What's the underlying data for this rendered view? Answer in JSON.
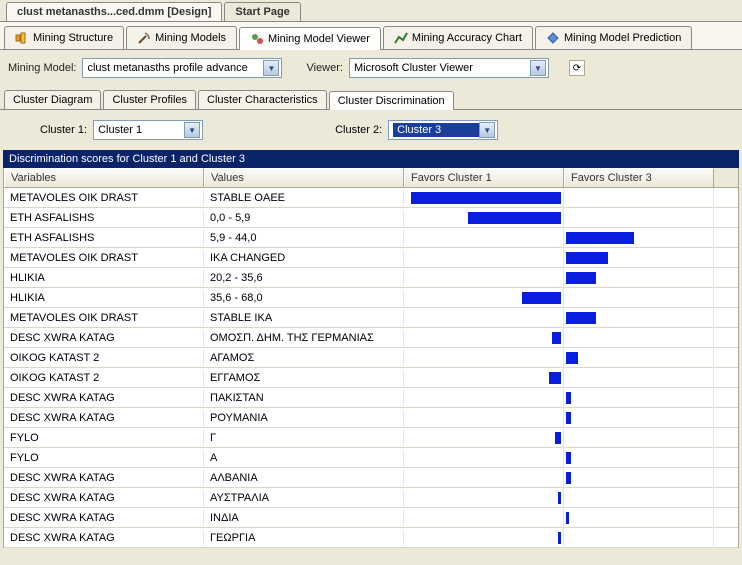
{
  "topTabs": {
    "design": "clust metanasths...ced.dmm [Design]",
    "startPage": "Start Page"
  },
  "toolTabs": {
    "miningStructure": "Mining Structure",
    "miningModels": "Mining Models",
    "miningModelViewer": "Mining Model Viewer",
    "miningAccuracyChart": "Mining Accuracy Chart",
    "miningModelPrediction": "Mining Model Prediction"
  },
  "labels": {
    "miningModel": "Mining Model:",
    "viewer": "Viewer:",
    "cluster1": "Cluster 1:",
    "cluster2": "Cluster 2:"
  },
  "dropdowns": {
    "miningModel": "clust metanasths profile advance",
    "viewer": "Microsoft Cluster Viewer",
    "cluster1": "Cluster 1",
    "cluster2": "Cluster 3"
  },
  "subTabs": {
    "clusterDiagram": "Cluster Diagram",
    "clusterProfiles": "Cluster Profiles",
    "clusterCharacteristics": "Cluster Characteristics",
    "clusterDiscrimination": "Cluster Discrimination"
  },
  "titleBar": "Discrimination scores for Cluster 1 and Cluster 3",
  "columns": {
    "variables": "Variables",
    "values": "Values",
    "favors1": "Favors Cluster 1",
    "favors2": "Favors Cluster 3"
  },
  "rows": [
    {
      "var": "METAVOLES OIK DRAST",
      "val": "STABLE OAEE",
      "f1": 100,
      "f2": 0
    },
    {
      "var": "ETH ASFALISHS",
      "val": "0,0 - 5,9",
      "f1": 62,
      "f2": 0
    },
    {
      "var": "ETH ASFALISHS",
      "val": "5,9 - 44,0",
      "f1": 0,
      "f2": 45
    },
    {
      "var": "METAVOLES OIK DRAST",
      "val": "IKA CHANGED",
      "f1": 0,
      "f2": 28
    },
    {
      "var": "HLIKIA",
      "val": "20,2 - 35,6",
      "f1": 0,
      "f2": 20
    },
    {
      "var": "HLIKIA",
      "val": "35,6 - 68,0",
      "f1": 26,
      "f2": 0
    },
    {
      "var": "METAVOLES OIK DRAST",
      "val": "STABLE IKA",
      "f1": 0,
      "f2": 20
    },
    {
      "var": "DESC XWRA KATAG",
      "val": "ΟΜΟΣΠ. ΔΗΜ. ΤΗΣ ΓΕΡΜΑΝΙΑΣ",
      "f1": 6,
      "f2": 0
    },
    {
      "var": "OIKOG KATAST 2",
      "val": "ΑΓΑΜΟΣ",
      "f1": 0,
      "f2": 8
    },
    {
      "var": "OIKOG KATAST 2",
      "val": "ΕΓΓΑΜΟΣ",
      "f1": 8,
      "f2": 0
    },
    {
      "var": "DESC XWRA KATAG",
      "val": "ΠΑΚΙΣΤΑΝ",
      "f1": 0,
      "f2": 3
    },
    {
      "var": "DESC XWRA KATAG",
      "val": "ΡΟΥΜΑΝΙΑ",
      "f1": 0,
      "f2": 3
    },
    {
      "var": "FYLO",
      "val": "Γ",
      "f1": 4,
      "f2": 0
    },
    {
      "var": "FYLO",
      "val": "Α",
      "f1": 0,
      "f2": 3
    },
    {
      "var": "DESC XWRA KATAG",
      "val": "ΑΛΒΑΝΙΑ",
      "f1": 0,
      "f2": 3
    },
    {
      "var": "DESC XWRA KATAG",
      "val": "ΑΥΣΤΡΑΛΙΑ",
      "f1": 2,
      "f2": 0
    },
    {
      "var": "DESC XWRA KATAG",
      "val": "ΙΝΔΙΑ",
      "f1": 0,
      "f2": 2
    },
    {
      "var": "DESC XWRA KATAG",
      "val": "ΓΕΩΡΓΙΑ",
      "f1": 2,
      "f2": 0
    }
  ]
}
